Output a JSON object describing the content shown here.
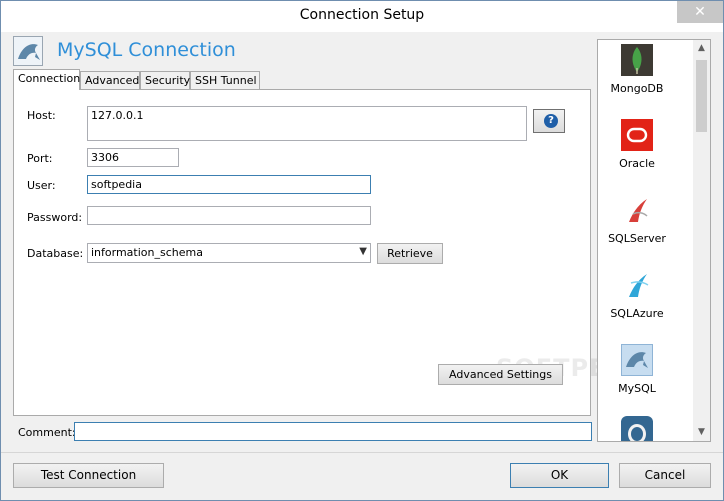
{
  "window": {
    "title": "Connection Setup",
    "close_glyph": "✕"
  },
  "header": {
    "title": "MySQL Connection",
    "icon": "mysql-dolphin-icon"
  },
  "tabs": [
    {
      "label": "Connection",
      "active": true
    },
    {
      "label": "Advanced",
      "active": false
    },
    {
      "label": "Security",
      "active": false
    },
    {
      "label": "SSH Tunnel",
      "active": false
    }
  ],
  "form": {
    "host_label": "Host:",
    "host_value": "127.0.0.1",
    "help_glyph": "?",
    "port_label": "Port:",
    "port_value": "3306",
    "user_label": "User:",
    "user_value": "softpedia",
    "password_label": "Password:",
    "password_value": "",
    "database_label": "Database:",
    "database_value": "information_schema",
    "retrieve_label": "Retrieve",
    "advanced_settings_label": "Advanced Settings",
    "watermark": "SOFTPEDIA"
  },
  "comment": {
    "label": "Comment:",
    "value": ""
  },
  "sidebar": {
    "items": [
      {
        "label": "MongoDB",
        "icon": "mongodb-leaf-icon",
        "selected": false
      },
      {
        "label": "Oracle",
        "icon": "oracle-icon",
        "selected": false
      },
      {
        "label": "SQLServer",
        "icon": "sqlserver-icon",
        "selected": false
      },
      {
        "label": "SQLAzure",
        "icon": "sqlazure-icon",
        "selected": false
      },
      {
        "label": "MySQL",
        "icon": "mysql-dolphin-icon",
        "selected": true
      },
      {
        "label": "",
        "icon": "postgresql-elephant-icon",
        "selected": false
      }
    ],
    "scroll_up_glyph": "▲",
    "scroll_down_glyph": "▼"
  },
  "footer": {
    "test_label": "Test Connection",
    "ok_label": "OK",
    "cancel_label": "Cancel"
  },
  "colors": {
    "accent": "#2f8fd8",
    "window_border": "#6f8eaf",
    "focus_border": "#3c7fb1"
  }
}
